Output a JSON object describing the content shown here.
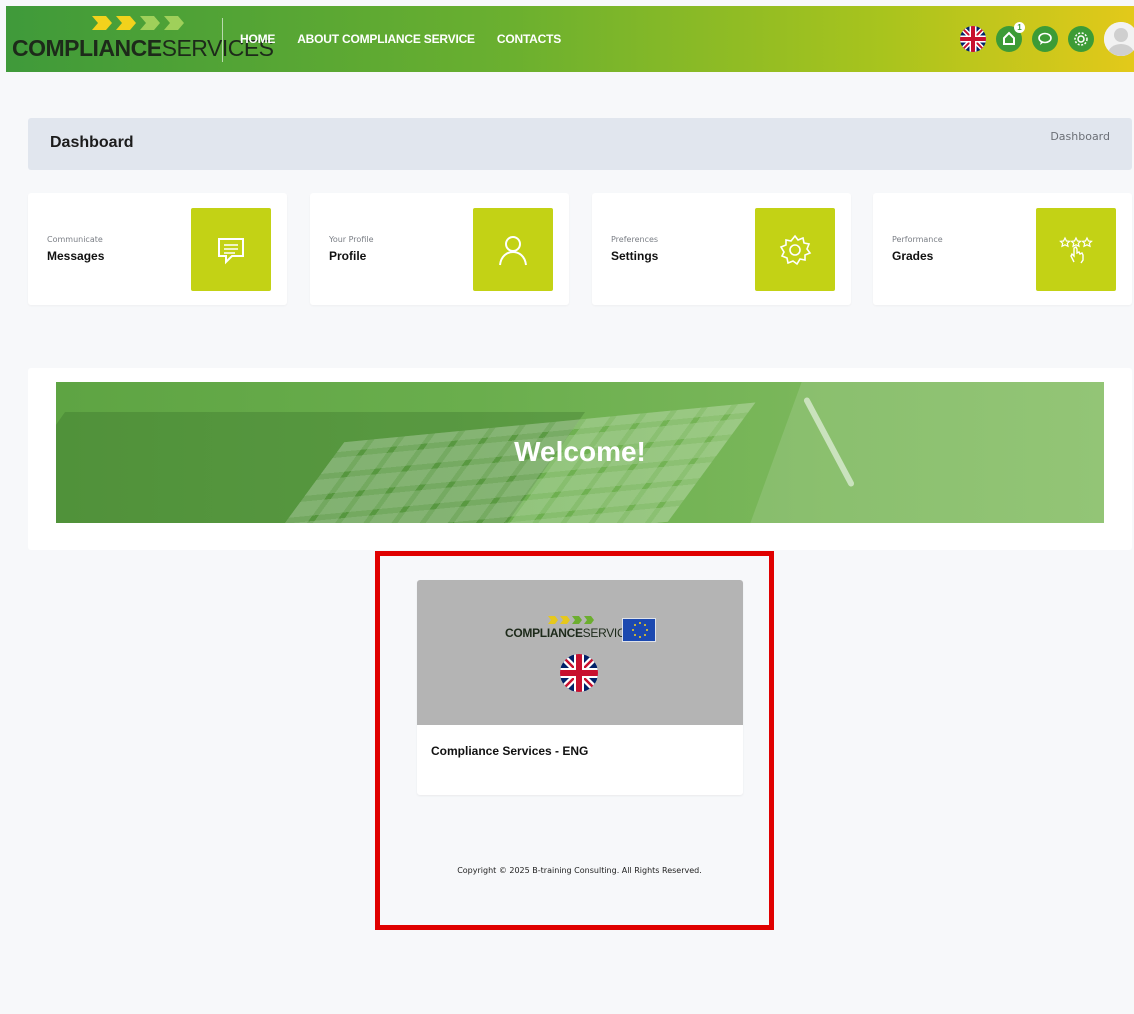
{
  "brand": {
    "bold": "COMPLIANCE",
    "light": "SERVICES"
  },
  "nav": {
    "home": "HOME",
    "about": "ABOUT COMPLIANCE SERVICE",
    "contacts": "CONTACTS",
    "notification_count": "1"
  },
  "breadcrumb": {
    "title": "Dashboard",
    "current": "Dashboard"
  },
  "cards": [
    {
      "small": "Communicate",
      "label": "Messages",
      "icon": "message-icon"
    },
    {
      "small": "Your Profile",
      "label": "Profile",
      "icon": "user-icon"
    },
    {
      "small": "Preferences",
      "label": "Settings",
      "icon": "gear-icon"
    },
    {
      "small": "Performance",
      "label": "Grades",
      "icon": "stars-hand-icon"
    }
  ],
  "welcome": {
    "text": "Welcome!"
  },
  "course": {
    "title": "Compliance Services - ENG",
    "brand_bold": "COMPLIANCE",
    "brand_light": "SERVICES"
  },
  "footer": {
    "copyright": "Copyright © 2025 B-training Consulting. All Rights Reserved."
  },
  "colors": {
    "accent": "#c3d215",
    "nav_green": "#3c9b36",
    "highlight": "#e00000"
  }
}
